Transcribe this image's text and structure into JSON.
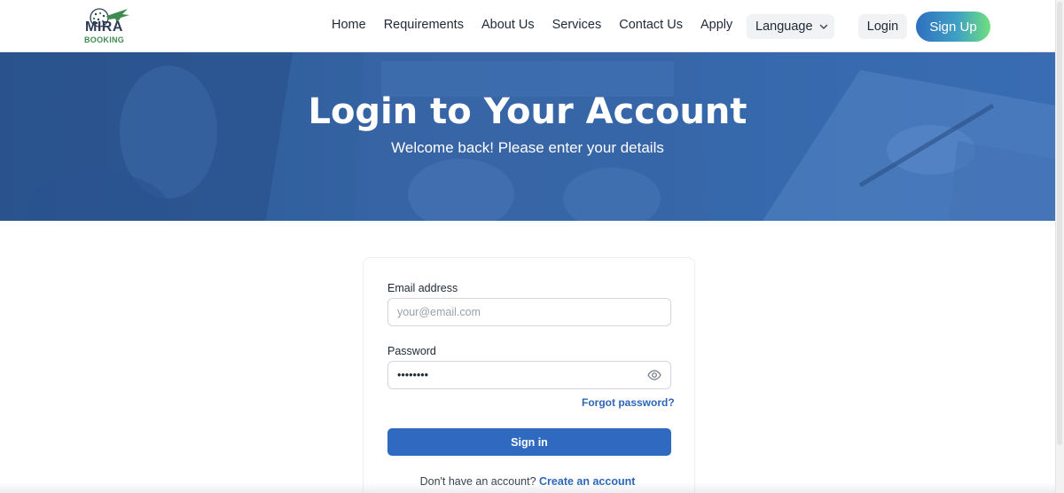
{
  "brand": {
    "name_line1": "MIRA",
    "name_line2": "BOOKING",
    "logo_icon": "globe-plane-icon",
    "primary_color": "#2f6ac0",
    "accent_green": "#3f8b4f"
  },
  "nav": {
    "links": [
      "Home",
      "Requirements",
      "About Us",
      "Services",
      "Contact Us",
      "Apply"
    ],
    "language_label": "Language",
    "language_icon": "chevron-down-icon",
    "login_label": "Login",
    "signup_label": "Sign Up"
  },
  "hero": {
    "title": "Login to Your Account",
    "subtitle": "Welcome back! Please enter your details"
  },
  "form": {
    "email_label": "Email address",
    "email_placeholder": "your@email.com",
    "email_value": "",
    "password_label": "Password",
    "password_value": "password",
    "password_toggle_icon": "eye-icon",
    "forgot_label": "Forgot password?",
    "submit_label": "Sign in",
    "no_account_text": "Don't have an account?",
    "create_account_label": "Create an account"
  }
}
